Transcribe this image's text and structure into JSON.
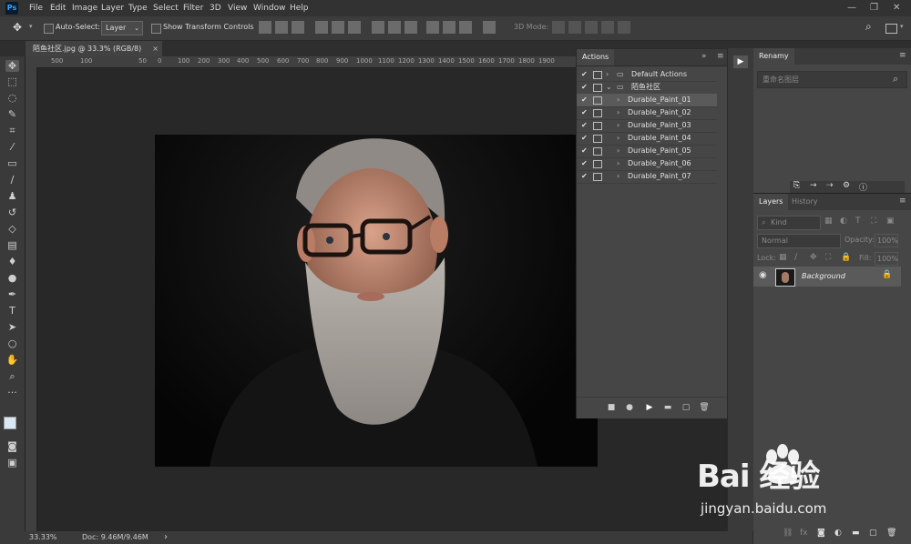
{
  "app": {
    "logo": "Ps",
    "menu": [
      "File",
      "Edit",
      "Image",
      "Layer",
      "Type",
      "Select",
      "Filter",
      "3D",
      "View",
      "Window",
      "Help"
    ],
    "window_controls": [
      "—",
      "❐",
      "✕"
    ]
  },
  "options_bar": {
    "auto_select_label": "Auto-Select:",
    "auto_select_value": "Layer",
    "transform_label": "Show Transform Controls",
    "mode_label": "3D Mode:"
  },
  "document": {
    "tab_title": "陌鱼社区.jpg @ 33.3% (RGB/8)",
    "tab_close": "×",
    "ruler_labels": [
      "500",
      "100",
      "50",
      "0",
      "100",
      "200",
      "300",
      "400",
      "500",
      "600",
      "700",
      "800",
      "900",
      "1000",
      "1100",
      "1200",
      "1300",
      "1400",
      "1500",
      "1600",
      "1700",
      "1800",
      "1900"
    ]
  },
  "status": {
    "zoom": "33.33%",
    "doc": "Doc: 9.46M/9.46M",
    "arrow": "›"
  },
  "actions_panel": {
    "title": "Actions",
    "rows": [
      {
        "label": "Default Actions",
        "indent": 0,
        "folder": true,
        "open": false,
        "selected": false
      },
      {
        "label": "陌鱼社区",
        "indent": 0,
        "folder": true,
        "open": true,
        "selected": false
      },
      {
        "label": "Durable_Paint_01",
        "indent": 1,
        "folder": false,
        "open": false,
        "selected": true
      },
      {
        "label": "Durable_Paint_02",
        "indent": 1,
        "folder": false,
        "open": false,
        "selected": false
      },
      {
        "label": "Durable_Paint_03",
        "indent": 1,
        "folder": false,
        "open": false,
        "selected": false
      },
      {
        "label": "Durable_Paint_04",
        "indent": 1,
        "folder": false,
        "open": false,
        "selected": false
      },
      {
        "label": "Durable_Paint_05",
        "indent": 1,
        "folder": false,
        "open": false,
        "selected": false
      },
      {
        "label": "Durable_Paint_06",
        "indent": 1,
        "folder": false,
        "open": false,
        "selected": false
      },
      {
        "label": "Durable_Paint_07",
        "indent": 1,
        "folder": false,
        "open": false,
        "selected": false
      }
    ]
  },
  "renamy_panel": {
    "title": "Renamy",
    "placeholder": "重命名图层"
  },
  "layers_panel": {
    "tabs": [
      "Layers",
      "History"
    ],
    "kind_label": "Kind",
    "blend_mode": "Normal",
    "opacity_label": "Opacity:",
    "opacity_value": "100%",
    "lock_label": "Lock:",
    "fill_label": "Fill:",
    "fill_value": "100%",
    "layer_name": "Background"
  },
  "watermark": {
    "text": "Bai  经验",
    "url": "jingyan.baidu.com"
  }
}
